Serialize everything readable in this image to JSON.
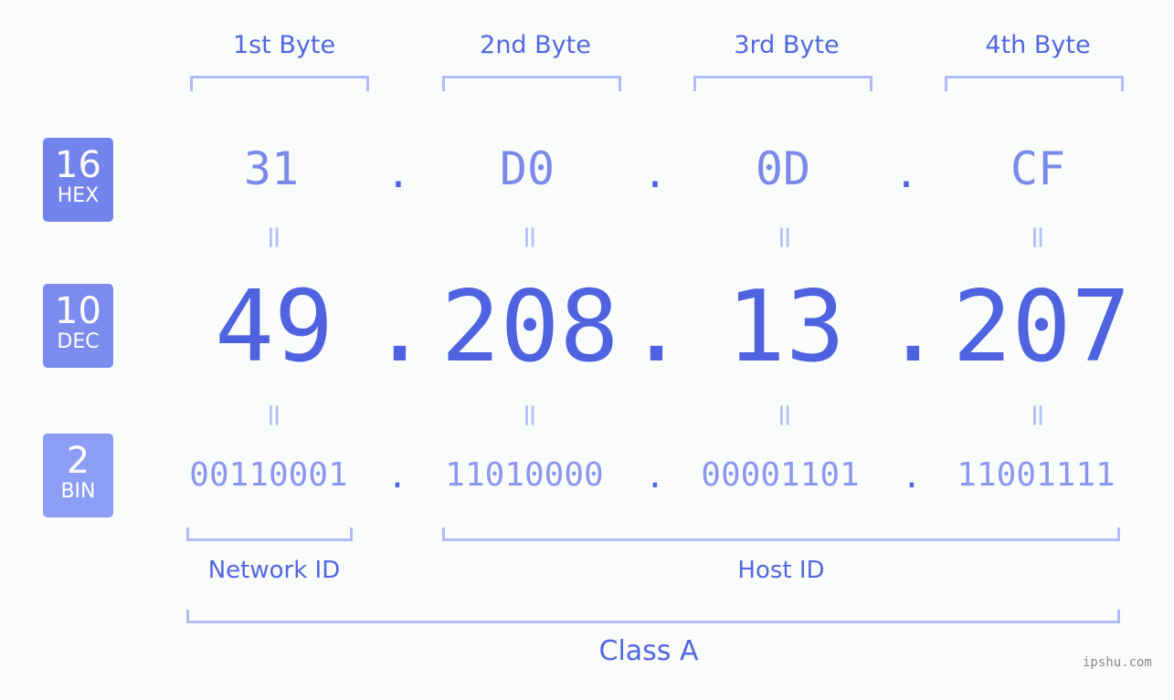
{
  "bytes": [
    {
      "label": "1st Byte",
      "hex": "31",
      "dec": "49",
      "bin": "00110001"
    },
    {
      "label": "2nd Byte",
      "hex": "D0",
      "dec": "208",
      "bin": "11010000"
    },
    {
      "label": "3rd Byte",
      "hex": "0D",
      "dec": "13",
      "bin": "00001101"
    },
    {
      "label": "4th Byte",
      "hex": "CF",
      "dec": "207",
      "bin": "11001111"
    }
  ],
  "separator": ".",
  "equals": "=",
  "badges": {
    "hex": {
      "number": "16",
      "label": "HEX",
      "color": "#7383ec"
    },
    "dec": {
      "number": "10",
      "label": "DEC",
      "color": "#7b8bee"
    },
    "bin": {
      "number": "2",
      "label": "BIN",
      "color": "#8c9df5"
    }
  },
  "parts": {
    "network": "Network ID",
    "host": "Host ID",
    "class": "Class A"
  },
  "footer": "ipshu.com"
}
